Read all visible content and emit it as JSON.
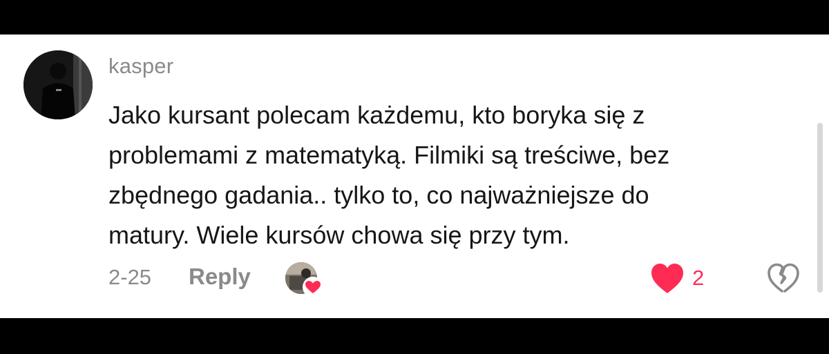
{
  "comment": {
    "username": "kasper",
    "lines": [
      "Jako kursant polecam każdemu, kto boryka się z",
      "problemami z matematyką. Filmiki są treściwe, bez",
      "zbędnego gadania.. tylko to, co najważniejsze do",
      "matury. Wiele kursów chowa się przy tym."
    ],
    "date": "2-25",
    "reply_label": "Reply",
    "likes": "2"
  },
  "colors": {
    "like_red": "#fe2c55",
    "muted_text": "#8a8a8a",
    "body_text": "#161616"
  },
  "icons": {
    "avatar": "user-avatar",
    "creator_liked": "creator-liked-heart-icon",
    "like": "heart-icon",
    "dislike": "broken-heart-icon"
  }
}
